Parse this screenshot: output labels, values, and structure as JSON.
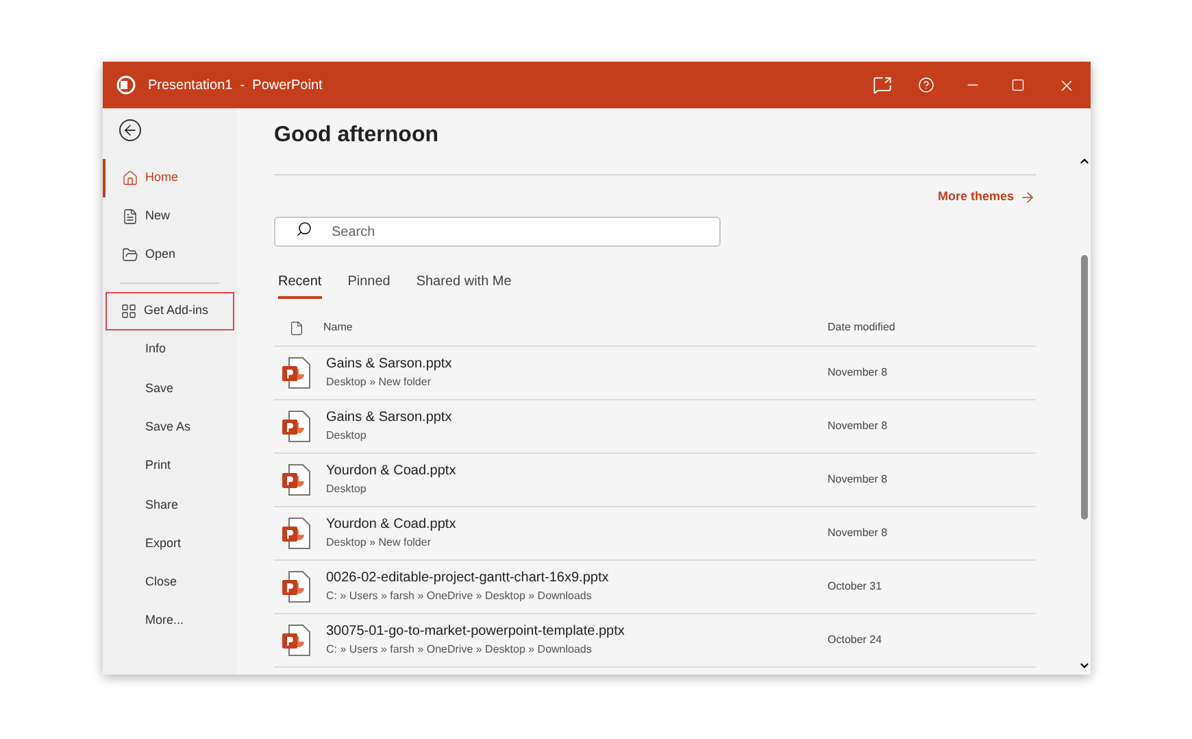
{
  "window": {
    "title": "Presentation1  -  PowerPoint"
  },
  "sidebar": {
    "nav": [
      {
        "label": "Home",
        "selected": true
      },
      {
        "label": "New",
        "selected": false
      },
      {
        "label": "Open",
        "selected": false
      }
    ],
    "addins": {
      "label": "Get Add-ins",
      "highlighted": true
    },
    "items": [
      "Info",
      "Save",
      "Save As",
      "Print",
      "Share",
      "Export",
      "Close",
      "More..."
    ]
  },
  "main": {
    "greeting": "Good afternoon",
    "more_themes": "More themes",
    "search": {
      "placeholder": "Search"
    },
    "tabs": [
      {
        "label": "Recent",
        "selected": true
      },
      {
        "label": "Pinned",
        "selected": false
      },
      {
        "label": "Shared with Me",
        "selected": false
      }
    ],
    "table": {
      "columns": [
        "Name",
        "Date modified"
      ],
      "rows": [
        {
          "name": "Gains & Sarson.pptx",
          "path": "Desktop » New folder",
          "date": "November 8"
        },
        {
          "name": "Gains & Sarson.pptx",
          "path": "Desktop",
          "date": "November 8"
        },
        {
          "name": "Yourdon & Coad.pptx",
          "path": "Desktop",
          "date": "November 8"
        },
        {
          "name": "Yourdon & Coad.pptx",
          "path": "Desktop » New folder",
          "date": "November 8"
        },
        {
          "name": "0026-02-editable-project-gantt-chart-16x9.pptx",
          "path": "C: » Users » farsh » OneDrive » Desktop » Downloads",
          "date": "October 31"
        },
        {
          "name": "30075-01-go-to-market-powerpoint-template.pptx",
          "path": "C: » Users » farsh » OneDrive » Desktop » Downloads",
          "date": "October 24"
        }
      ]
    }
  }
}
